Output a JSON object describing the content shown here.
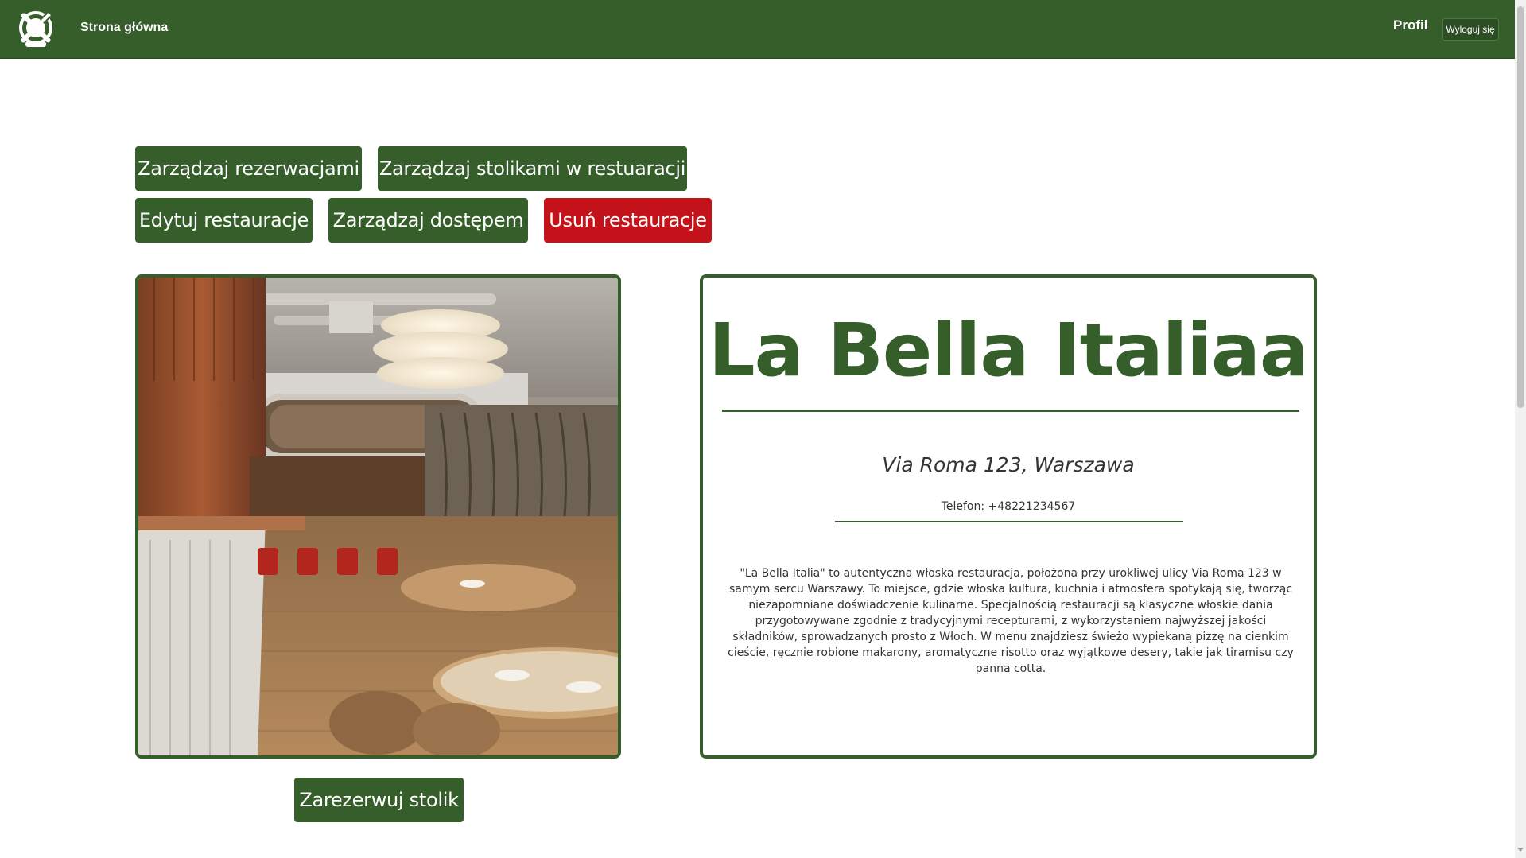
{
  "navbar": {
    "home_label": "Strona główna",
    "profile_label": "Profil",
    "logout_label": "Wyloguj się",
    "logo_icon": "crossed-fork-knife-plate-logo",
    "brand_color": "#355e2a"
  },
  "actions": {
    "manage_reservations": "Zarządzaj rezerwacjami",
    "manage_tables": "Zarządzaj stolikami w restuaracji",
    "edit_restaurant": "Edytuj restauracje",
    "manage_access": "Zarządzaj dostępem",
    "delete_restaurant": "Usuń restauracje",
    "danger_color": "#c4121a"
  },
  "restaurant": {
    "name": "La Bella Italiaa",
    "address": "Via Roma 123, Warszawa",
    "phone": "Telefon: +48221234567",
    "description": "\"La Bella Italia\" to autentyczna włoska restauracja, położona przy urokliwej ulicy Via Roma 123 w samym sercu Warszawy. To miejsce, gdzie włoska kultura, kuchnia i atmosfera spotykają się, tworząc niezapomniane doświadczenie kulinarne. Specjalnością restauracji są klasyczne włoskie dania przygotowywane zgodnie z tradycyjnymi recepturami, z wykorzystaniem najwyższej jakości składników, sprowadzanych prosto z Włoch. W menu znajdziesz świeżo wypiekaną pizzę na cienkim cieście, ręcznie robione makarony, aromatyczne risotto oraz wyjątkowe desery, takie jak tiramisu czy panna cotta."
  },
  "reserve": {
    "label": "Zarezerwuj stolik"
  }
}
